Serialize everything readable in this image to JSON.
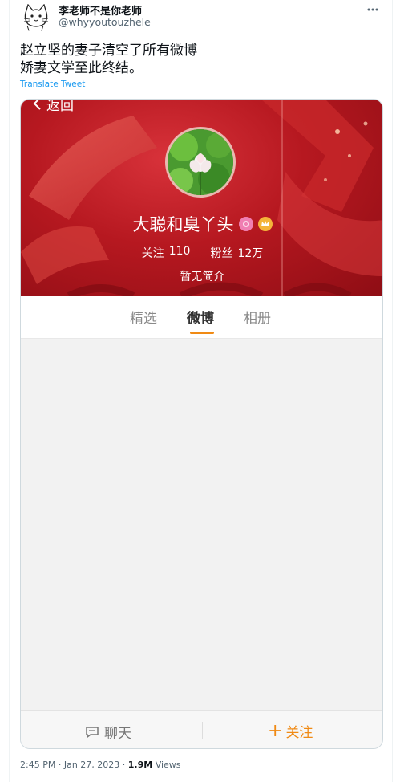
{
  "tweet": {
    "author": {
      "display_name": "李老师不是你老师",
      "handle": "@whyyoutouzhele",
      "avatar_icon": "cat-sketch-avatar"
    },
    "more_icon": "more-horizontal-icon",
    "text_lines": [
      "赵立坚的妻子清空了所有微博",
      "娇妻文学至此终结。"
    ],
    "translate_label": "Translate Tweet",
    "meta": {
      "time": "2:45 PM",
      "separator": "·",
      "date": "Jan 27, 2023",
      "views_count": "1.9M",
      "views_label": "Views"
    }
  },
  "embedded_screenshot": {
    "back_label": "返回",
    "profile": {
      "name": "大聪和臭丫头",
      "following_label": "关注",
      "following_count": "110",
      "followers_label": "粉丝",
      "followers_count": "12万",
      "bio": "暂无简介",
      "banner_color": "#b61820"
    },
    "tabs": [
      {
        "label": "精选",
        "active": false
      },
      {
        "label": "微博",
        "active": true
      },
      {
        "label": "相册",
        "active": false
      }
    ],
    "accent_color": "#f08a14",
    "bottom_bar": {
      "chat_label": "聊天",
      "follow_plus": "+",
      "follow_label": "关注"
    }
  }
}
